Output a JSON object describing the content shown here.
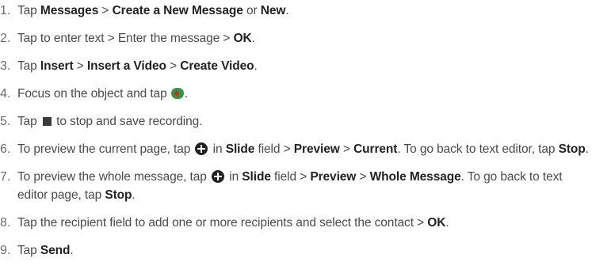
{
  "steps": [
    {
      "num": "1.",
      "parts": [
        "Tap ",
        "Messages",
        " > ",
        "Create a New Message",
        " or ",
        "New",
        "."
      ]
    },
    {
      "num": "2.",
      "parts": [
        "Tap to enter text > Enter the message > ",
        "OK",
        "."
      ]
    },
    {
      "num": "3.",
      "parts": [
        "Tap ",
        "Insert",
        " > ",
        "Insert a Video",
        " > ",
        "Create Video",
        "."
      ]
    },
    {
      "num": "4.",
      "parts": [
        "Focus on the object and tap ",
        "."
      ],
      "icon_name": "record-icon",
      "icon_text": "REC"
    },
    {
      "num": "5.",
      "parts": [
        "Tap ",
        " to stop and save recording."
      ],
      "icon_name": "stop-icon"
    },
    {
      "num": "6.",
      "parts": [
        "To preview the current page, tap ",
        " in ",
        "Slide",
        " field > ",
        "Preview",
        " > ",
        "Current",
        ". To go back to text editor, tap ",
        "Stop",
        "."
      ],
      "icon_name": "add-circle-icon"
    },
    {
      "num": "7.",
      "parts": [
        "To preview the whole message, tap ",
        " in ",
        "Slide",
        " field > ",
        "Preview",
        " > ",
        "Whole Message",
        ". To go back to text editor page, tap ",
        "Stop",
        "."
      ],
      "icon_name": "add-circle-icon"
    },
    {
      "num": "8.",
      "parts": [
        "Tap the recipient field to add one or more recipients and select the contact > ",
        "OK",
        "."
      ]
    },
    {
      "num": "9.",
      "parts": [
        "Tap ",
        "Send",
        "."
      ]
    }
  ],
  "colors": {
    "text": "#4a4a4a",
    "bold_text": "#222222",
    "rec_green": "#2e9b3a",
    "rec_red": "#d8262d"
  }
}
